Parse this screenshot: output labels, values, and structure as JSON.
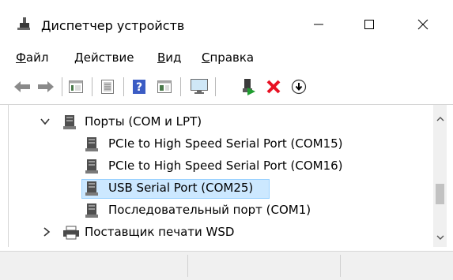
{
  "window": {
    "title": "Диспетчер устройств",
    "app_icon": "device-manager-icon"
  },
  "menu": {
    "items": [
      {
        "accel": "Ф",
        "rest": "айл"
      },
      {
        "accel": "Д",
        "rest": "ействие"
      },
      {
        "accel": "В",
        "rest": "ид"
      },
      {
        "accel": "С",
        "rest": "правка"
      }
    ]
  },
  "toolbar": {
    "buttons": [
      "back-arrow-icon",
      "forward-arrow-icon",
      "properties-icon",
      "driver-icon",
      "help-icon",
      "view-icon",
      "monitor-icon",
      "enable-device-icon",
      "uninstall-x-icon",
      "update-driver-icon"
    ]
  },
  "tree": {
    "group_label": "Порты (COM и LPT)",
    "ports": [
      "PCIe to High Speed Serial Port (COM15)",
      "PCIe to High Speed Serial Port (COM16)",
      "USB Serial Port (COM25)",
      "Последовательный порт (COM1)"
    ],
    "next_group": "Поставщик печати WSD",
    "selected_index": 2
  },
  "colors": {
    "selection_fill": "#cce8ff",
    "selection_border": "#99d1ff",
    "uninstall_red": "#e81123",
    "help_blue": "#3b5cc4"
  }
}
